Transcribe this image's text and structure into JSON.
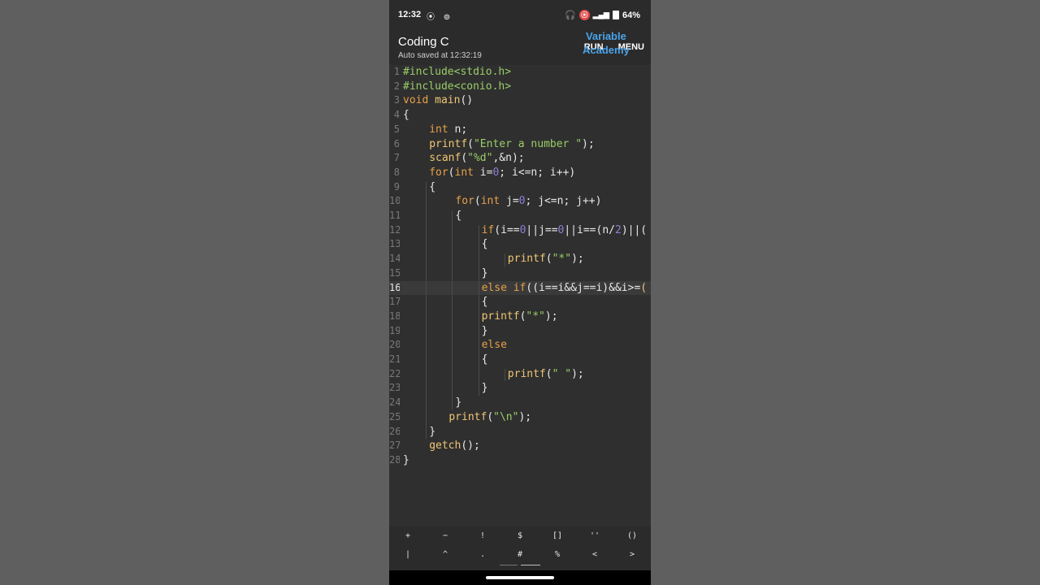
{
  "status_bar": {
    "time": "12:32",
    "left_icons": "⦿ ⊚",
    "right_icons": "🎧",
    "rec_icon": "⦿",
    "signal": "▂▄▆",
    "battery": "64%"
  },
  "app_bar": {
    "title": "Coding C",
    "subtitle": "Auto saved at 12:32:19",
    "run_label": "RUN",
    "menu_label": "MENU",
    "watermark_line1": "Variable",
    "watermark_line2": "Academy"
  },
  "editor": {
    "active_line": 16,
    "lines": [
      {
        "n": "1"
      },
      {
        "n": "2"
      },
      {
        "n": "3"
      },
      {
        "n": "4"
      },
      {
        "n": "5"
      },
      {
        "n": "6"
      },
      {
        "n": "7"
      },
      {
        "n": "8"
      },
      {
        "n": "9"
      },
      {
        "n": "10"
      },
      {
        "n": "11"
      },
      {
        "n": "12"
      },
      {
        "n": "13"
      },
      {
        "n": "14"
      },
      {
        "n": "15"
      },
      {
        "n": "16"
      },
      {
        "n": "17"
      },
      {
        "n": "18"
      },
      {
        "n": "19"
      },
      {
        "n": "20"
      },
      {
        "n": "21"
      },
      {
        "n": "22"
      },
      {
        "n": "23"
      },
      {
        "n": "24"
      },
      {
        "n": "25"
      },
      {
        "n": "26"
      },
      {
        "n": "27"
      },
      {
        "n": "28"
      }
    ],
    "tokens": {
      "l1": [
        "#include<stdio.h>"
      ],
      "l2": [
        "#include<conio.h>"
      ],
      "l3": [
        "void",
        " ",
        "main",
        "()"
      ],
      "l4": [
        "{"
      ],
      "l5": [
        "int",
        " n;"
      ],
      "l6": [
        "printf",
        "(",
        "\"Enter a number \"",
        ");"
      ],
      "l7": [
        "scanf",
        "(",
        "\"%d\"",
        ",&n);"
      ],
      "l8": [
        "for",
        "(",
        "int",
        " i=",
        "0",
        "; i<=n; i++)"
      ],
      "l9": [
        "{"
      ],
      "l10": [
        "for",
        "(",
        "int",
        " j=",
        "0",
        "; j<=n; j++)"
      ],
      "l11": [
        "{"
      ],
      "l12": [
        "if",
        "(i==",
        "0",
        "||j==",
        "0",
        "||i==(n/",
        "2",
        ")||("
      ],
      "l13": [
        "{"
      ],
      "l14": [
        "printf",
        "(",
        "\"*\"",
        ");"
      ],
      "l15": [
        "}"
      ],
      "l16": [
        "else",
        " ",
        "if",
        "((i==i&&j==i)&&i>=",
        "("
      ],
      "l17": [
        "{"
      ],
      "l18": [
        "printf",
        "(",
        "\"*\"",
        ");"
      ],
      "l19": [
        "}"
      ],
      "l20": [
        "else"
      ],
      "l21": [
        "{"
      ],
      "l22": [
        "printf",
        "(",
        "\" \"",
        ");"
      ],
      "l23": [
        "}"
      ],
      "l24": [
        "}"
      ],
      "l25": [
        "printf",
        "(",
        "\"\\n\"",
        ");"
      ],
      "l26": [
        "}"
      ],
      "l27": [
        "getch",
        "();"
      ],
      "l28": [
        "}"
      ]
    }
  },
  "keybar": {
    "row1": [
      "+",
      "−",
      "!",
      "$",
      "[]",
      "''",
      "()"
    ],
    "row2": [
      "|",
      "^",
      ".",
      "#",
      "%",
      "<",
      ">"
    ]
  },
  "colors": {
    "keyword": "#e6a14a",
    "function": "#f0c674",
    "string": "#9acd68",
    "number": "#8e7fd6",
    "watermark": "#4aa3e8"
  }
}
